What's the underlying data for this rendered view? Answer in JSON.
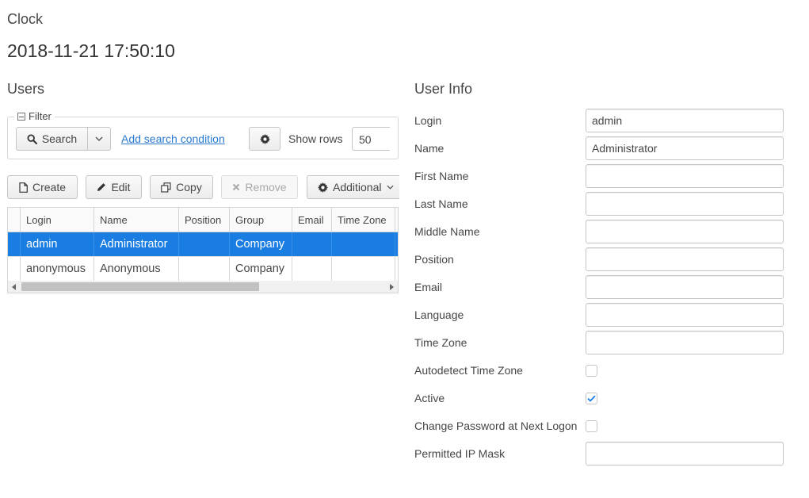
{
  "clock": {
    "caption": "Clock",
    "value": "2018-11-21 17:50:10"
  },
  "users": {
    "title": "Users",
    "filter": {
      "legend": "Filter",
      "search_label": "Search",
      "add_condition_link": "Add search condition",
      "show_rows_label": "Show rows",
      "show_rows_value": "50"
    },
    "buttons": {
      "create": "Create",
      "edit": "Edit",
      "copy": "Copy",
      "remove": "Remove",
      "additional": "Additional"
    },
    "table": {
      "columns": [
        "Login",
        "Name",
        "Position",
        "Group",
        "Email",
        "Time Zone"
      ],
      "rows": [
        {
          "login": "admin",
          "name": "Administrator",
          "position": "",
          "group": "Company",
          "email": "",
          "time_zone": "",
          "selected": true
        },
        {
          "login": "anonymous",
          "name": "Anonymous",
          "position": "",
          "group": "Company",
          "email": "",
          "time_zone": "",
          "selected": false
        }
      ]
    }
  },
  "user_info": {
    "title": "User Info",
    "fields": {
      "login": {
        "label": "Login",
        "value": "admin"
      },
      "name": {
        "label": "Name",
        "value": "Administrator"
      },
      "first_name": {
        "label": "First Name",
        "value": ""
      },
      "last_name": {
        "label": "Last Name",
        "value": ""
      },
      "middle_name": {
        "label": "Middle Name",
        "value": ""
      },
      "position": {
        "label": "Position",
        "value": ""
      },
      "email": {
        "label": "Email",
        "value": ""
      },
      "language": {
        "label": "Language",
        "value": ""
      },
      "time_zone": {
        "label": "Time Zone",
        "value": ""
      },
      "autodetect_time_zone": {
        "label": "Autodetect Time Zone",
        "checked": false
      },
      "active": {
        "label": "Active",
        "checked": true
      },
      "change_password": {
        "label": "Change Password at Next Logon",
        "checked": false
      },
      "permitted_ip_mask": {
        "label": "Permitted IP Mask",
        "value": ""
      }
    }
  },
  "colors": {
    "accent": "#197de1",
    "link": "#2a7ad2",
    "text": "#464646",
    "border": "#c5c5c5"
  }
}
